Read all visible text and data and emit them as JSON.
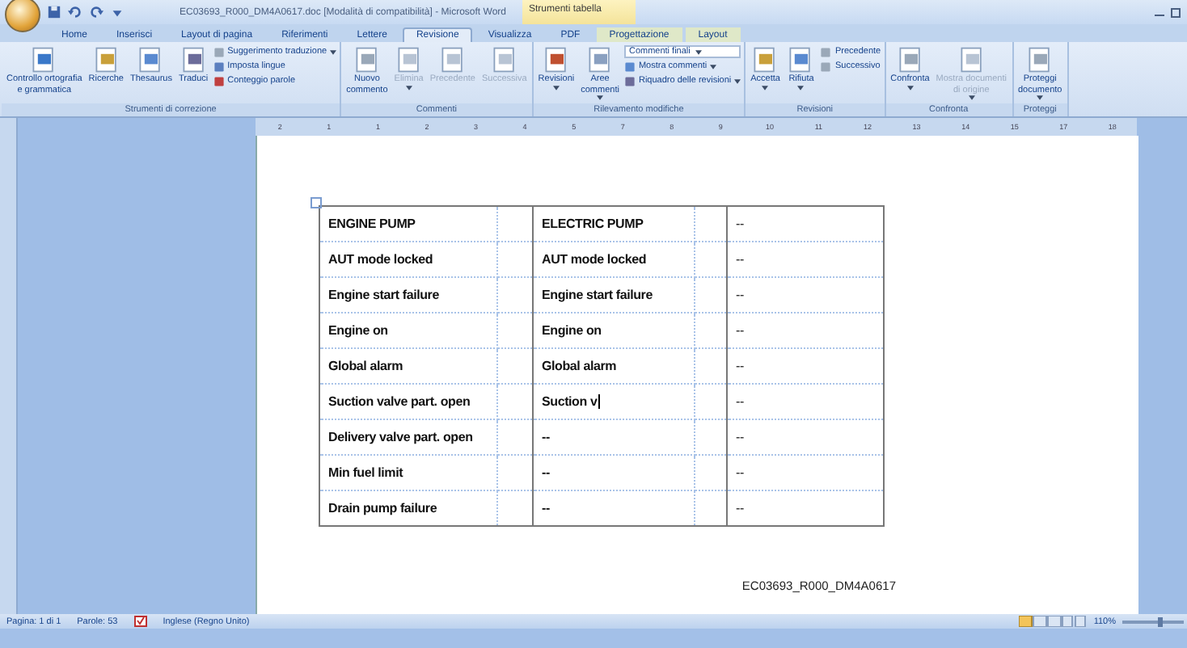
{
  "window": {
    "title": "EC03693_R000_DM4A0617.doc [Modalità di compatibilità] - Microsoft Word",
    "context_header": "Strumenti tabella"
  },
  "tabs": [
    {
      "label": "Home",
      "selected": false,
      "contextual": false
    },
    {
      "label": "Inserisci",
      "selected": false,
      "contextual": false
    },
    {
      "label": "Layout di pagina",
      "selected": false,
      "contextual": false
    },
    {
      "label": "Riferimenti",
      "selected": false,
      "contextual": false
    },
    {
      "label": "Lettere",
      "selected": false,
      "contextual": false
    },
    {
      "label": "Revisione",
      "selected": true,
      "contextual": false
    },
    {
      "label": "Visualizza",
      "selected": false,
      "contextual": false
    },
    {
      "label": "PDF",
      "selected": false,
      "contextual": false
    },
    {
      "label": "Progettazione",
      "selected": false,
      "contextual": true
    },
    {
      "label": "Layout",
      "selected": false,
      "contextual": true
    }
  ],
  "ribbon": {
    "groups": [
      {
        "label": "Strumenti di correzione",
        "buttons": [
          {
            "kind": "large",
            "label": "Controllo ortografia\ne grammatica",
            "disabled": false,
            "dropdown": false
          },
          {
            "kind": "large",
            "label": "Ricerche",
            "disabled": false,
            "dropdown": false
          },
          {
            "kind": "large",
            "label": "Thesaurus",
            "disabled": false,
            "dropdown": false
          },
          {
            "kind": "large",
            "label": "Traduci",
            "disabled": false,
            "dropdown": false
          },
          {
            "kind": "small",
            "label": "Suggerimento traduzione",
            "disabled": false,
            "dropdown": true
          },
          {
            "kind": "small",
            "label": "Imposta lingue",
            "disabled": false,
            "dropdown": false
          },
          {
            "kind": "small",
            "label": "Conteggio parole",
            "disabled": false,
            "dropdown": false
          }
        ]
      },
      {
        "label": "Commenti",
        "buttons": [
          {
            "kind": "large",
            "label": "Nuovo\ncommento",
            "disabled": false,
            "dropdown": false
          },
          {
            "kind": "large",
            "label": "Elimina",
            "disabled": true,
            "dropdown": true
          },
          {
            "kind": "large",
            "label": "Precedente",
            "disabled": true,
            "dropdown": false
          },
          {
            "kind": "large",
            "label": "Successiva",
            "disabled": true,
            "dropdown": false
          }
        ]
      },
      {
        "label": "Rilevamento modifiche",
        "buttons": [
          {
            "kind": "large",
            "label": "Revisioni",
            "disabled": false,
            "dropdown": true
          },
          {
            "kind": "large",
            "label": "Aree\ncommenti",
            "disabled": false,
            "dropdown": true
          },
          {
            "kind": "combo",
            "label": "Commenti finali",
            "disabled": false,
            "dropdown": true
          },
          {
            "kind": "small",
            "label": "Mostra commenti",
            "disabled": false,
            "dropdown": true
          },
          {
            "kind": "small",
            "label": "Riquadro delle revisioni",
            "disabled": false,
            "dropdown": true
          }
        ]
      },
      {
        "label": "Revisioni",
        "buttons": [
          {
            "kind": "large",
            "label": "Accetta",
            "disabled": false,
            "dropdown": true
          },
          {
            "kind": "large",
            "label": "Rifiuta",
            "disabled": false,
            "dropdown": true
          },
          {
            "kind": "small",
            "label": "Precedente",
            "disabled": false,
            "dropdown": false
          },
          {
            "kind": "small",
            "label": "Successivo",
            "disabled": false,
            "dropdown": false
          }
        ]
      },
      {
        "label": "Confronta",
        "buttons": [
          {
            "kind": "large",
            "label": "Confronta",
            "disabled": false,
            "dropdown": true
          },
          {
            "kind": "large",
            "label": "Mostra documenti\ndi origine",
            "disabled": true,
            "dropdown": true
          }
        ]
      },
      {
        "label": "Proteggi",
        "buttons": [
          {
            "kind": "large",
            "label": "Proteggi\ndocumento",
            "disabled": false,
            "dropdown": true
          }
        ]
      }
    ]
  },
  "ruler": {
    "numbers": [
      "2",
      "1",
      "1",
      "2",
      "3",
      "4",
      "5",
      "7",
      "8",
      "9",
      "10",
      "11",
      "12",
      "13",
      "14",
      "15",
      "17",
      "18"
    ]
  },
  "table": {
    "rows": [
      {
        "cells": [
          "ENGINE PUMP",
          "ELECTRIC PUMP",
          "--"
        ],
        "caret": false
      },
      {
        "cells": [
          "AUT mode locked",
          "AUT mode locked",
          "--"
        ],
        "caret": false
      },
      {
        "cells": [
          "Engine start failure",
          "Engine start failure",
          "--"
        ],
        "caret": false
      },
      {
        "cells": [
          "Engine on",
          "Engine on",
          "--"
        ],
        "caret": false
      },
      {
        "cells": [
          "Global alarm",
          "Global alarm",
          "--"
        ],
        "caret": false
      },
      {
        "cells": [
          "Suction valve part. open",
          "Suction v",
          "--"
        ],
        "caret": true
      },
      {
        "cells": [
          "Delivery valve part. open",
          "--",
          "--"
        ],
        "caret": false
      },
      {
        "cells": [
          "Min fuel limit",
          "--",
          "--"
        ],
        "caret": false
      },
      {
        "cells": [
          "Drain pump failure",
          "--",
          "--"
        ],
        "caret": false
      }
    ]
  },
  "footer": "EC03693_R000_DM4A0617",
  "status_bar": {
    "page": "Pagina: 1 di 1",
    "words": "Parole: 53",
    "language": "Inglese (Regno Unito)",
    "zoom": "110%",
    "zoom_slider": {
      "level": 0.6
    }
  }
}
